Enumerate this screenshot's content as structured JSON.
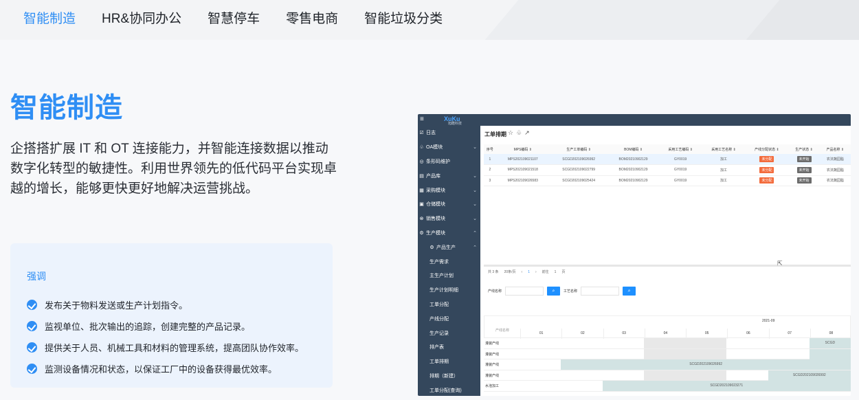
{
  "nav": {
    "tabs": [
      {
        "label": "智能制造",
        "active": true
      },
      {
        "label": "HR&协同办公",
        "active": false
      },
      {
        "label": "智慧停车",
        "active": false
      },
      {
        "label": "零售电商",
        "active": false
      },
      {
        "label": "智能垃圾分类",
        "active": false
      }
    ]
  },
  "hero": {
    "title": "智能制造",
    "description": "企搭搭扩展 IT 和 OT 连接能力，并智能连接数据以推动数字化转型的敏捷性。利用世界领先的低代码平台实现卓越的增长，能够更快更好地解决运营挑战。"
  },
  "emphasis": {
    "title": "强调",
    "items": [
      "发布关于物料发送或生产计划指令。",
      "监视单位、批次输出的追踪，创建完整的产品记录。",
      "提供关于人员、机械工具和材料的管理系统，提高团队协作效率。",
      "监测设备情况和状态，以保证工厂中的设备获得最优效率。"
    ]
  },
  "app": {
    "logo": "XuKu",
    "logo_sub": "旭酷科技",
    "sidebar": [
      {
        "label": "日志",
        "icon": "☑",
        "arrow": ""
      },
      {
        "label": "OA模块",
        "icon": "♧",
        "arrow": "⌄"
      },
      {
        "label": "条形码维护",
        "icon": "◎",
        "arrow": ""
      },
      {
        "label": "产品库",
        "icon": "▤",
        "arrow": "⌄"
      },
      {
        "label": "采购模块",
        "icon": "▦",
        "arrow": "⌄"
      },
      {
        "label": "仓储模块",
        "icon": "▣",
        "arrow": "⌄"
      },
      {
        "label": "销售模块",
        "icon": "⊗",
        "arrow": "⌄"
      },
      {
        "label": "生产模块",
        "icon": "⚙",
        "arrow": "⌃"
      },
      {
        "label": "产品生产",
        "icon": "⚙",
        "arrow": "⌃",
        "sub": true
      },
      {
        "label": "生产需求",
        "leaf": true
      },
      {
        "label": "主生产计划",
        "leaf": true
      },
      {
        "label": "生产计划明细",
        "leaf": true
      },
      {
        "label": "工单分配",
        "leaf": true
      },
      {
        "label": "产线分配",
        "leaf": true
      },
      {
        "label": "生产记录",
        "leaf": true
      },
      {
        "label": "排产表",
        "leaf": true
      },
      {
        "label": "工单排期",
        "leaf": true
      },
      {
        "label": "排期（新建）",
        "leaf": true
      },
      {
        "label": "工单分配(查询)",
        "leaf": true
      }
    ],
    "page_title": "工单排期",
    "table": {
      "headers": [
        "序号",
        "MPS编码 ⇕",
        "生产工单编码 ⇕",
        "BOM编码 ⇕",
        "采用工艺编码 ⇕",
        "采用工艺名称 ⇕",
        "产线分配状态 ⇕",
        "生产状态 ⇕",
        "产品名称 ⇕"
      ],
      "rows": [
        [
          "1",
          "MPS202109021107",
          "SCGD202109026992",
          "BOM20210902129",
          "GY0019",
          "加工",
          "未分配",
          "未开始",
          "农法蔬园脂"
        ],
        [
          "2",
          "MPS202109021518",
          "SCGD202109022799",
          "BOM20210902129",
          "GY0019",
          "加工",
          "未分配",
          "未开始",
          "农法蔬园脂"
        ],
        [
          "3",
          "MPS202109026583",
          "SCGD202109025424",
          "BOM20210902129",
          "GY0019",
          "加工",
          "未分配",
          "未开始",
          "农法蔬园脂"
        ]
      ]
    },
    "pager": {
      "total": "共 3 条",
      "per_page": "20条/页",
      "prev": "‹",
      "current": "1",
      "next": "›",
      "goto": "前往",
      "goto_value": "1",
      "page_unit": "页"
    },
    "filters": {
      "line_label": "产线名称",
      "process_label": "工艺名称",
      "search_icon": "search-icon"
    },
    "gantt": {
      "corner": "产线名称",
      "month": "2021-09",
      "days": [
        "01",
        "02",
        "03",
        "04",
        "05",
        "06",
        "07",
        "08"
      ],
      "rows": [
        {
          "label": "灌装产线",
          "bar_text": "SCGD"
        },
        {
          "label": "灌装产线",
          "bar_text": ""
        },
        {
          "label": "灌装产线",
          "bar_text": "SCGD202109026992"
        },
        {
          "label": "灌装产线",
          "bar_text": "SCGD202109026992"
        },
        {
          "label": "水泡加工",
          "bar_text": "SCGD202109023271"
        }
      ]
    },
    "colors": {
      "accent": "#2f8ef4",
      "sidebar": "#34475c",
      "red": "#f36b3c"
    }
  }
}
